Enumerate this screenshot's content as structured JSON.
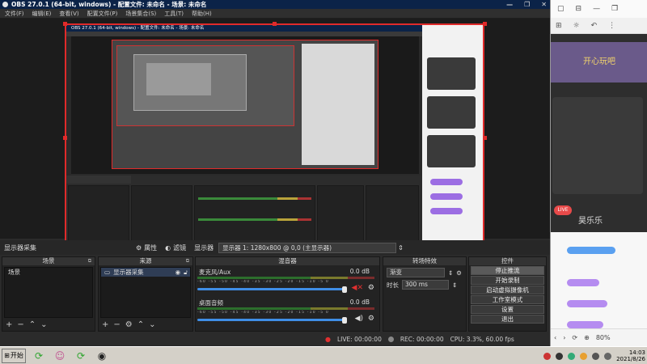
{
  "window": {
    "title": "OBS 27.0.1 (64-bit, windows) - 配置文件: 未命名 - 场景: 未命名",
    "controls": [
      "—",
      "❐",
      "✕"
    ]
  },
  "menu": [
    "文件(F)",
    "编辑(E)",
    "查看(V)",
    "配置文件(P)",
    "场景集合(S)",
    "工具(T)",
    "帮助(H)"
  ],
  "inner_title": "OBS 27.0.1 (64-bit, windows) - 配置文件: 未命名 - 场景: 未命名",
  "source_toolbar": {
    "source_name": "显示器采集",
    "properties": "属性",
    "filters": "滤镜",
    "display_label": "显示器",
    "display_value": "显示器 1: 1280x800 @ 0,0 (主显示器)"
  },
  "scenes": {
    "title": "场景",
    "items": [
      "场景"
    ]
  },
  "sources": {
    "title": "来源",
    "items": [
      "显示器采集"
    ]
  },
  "mixer": {
    "title": "混音器",
    "channels": [
      {
        "name": "麦克风/Aux",
        "db": "0.0 dB",
        "muted": true,
        "level": 0.84
      },
      {
        "name": "桌面音频",
        "db": "0.0 dB",
        "muted": false,
        "level": 0.84
      }
    ],
    "ticks": "-60 -55 -50 -45 -40 -35 -30 -25 -20 -15 -10 -5 0"
  },
  "transitions": {
    "title": "转场特效",
    "type": "渐变",
    "duration_label": "时长",
    "duration_value": "300 ms"
  },
  "controls": {
    "title": "控件",
    "buttons": [
      "停止推流",
      "开始录制",
      "启动虚拟摄像机",
      "工作室模式",
      "设置",
      "退出"
    ]
  },
  "status": {
    "live": "LIVE: 00:00:00",
    "rec": "REC: 00:00:00",
    "cpu": "CPU: 3.3%, 60.00 fps"
  },
  "browser": {
    "banner": "开心玩吧",
    "live_badge": "LIVE",
    "streamer_name": "昊乐乐",
    "zoom": "80%"
  },
  "taskbar": {
    "start": "开始",
    "time": "14:03",
    "date": "2021/8/26"
  }
}
